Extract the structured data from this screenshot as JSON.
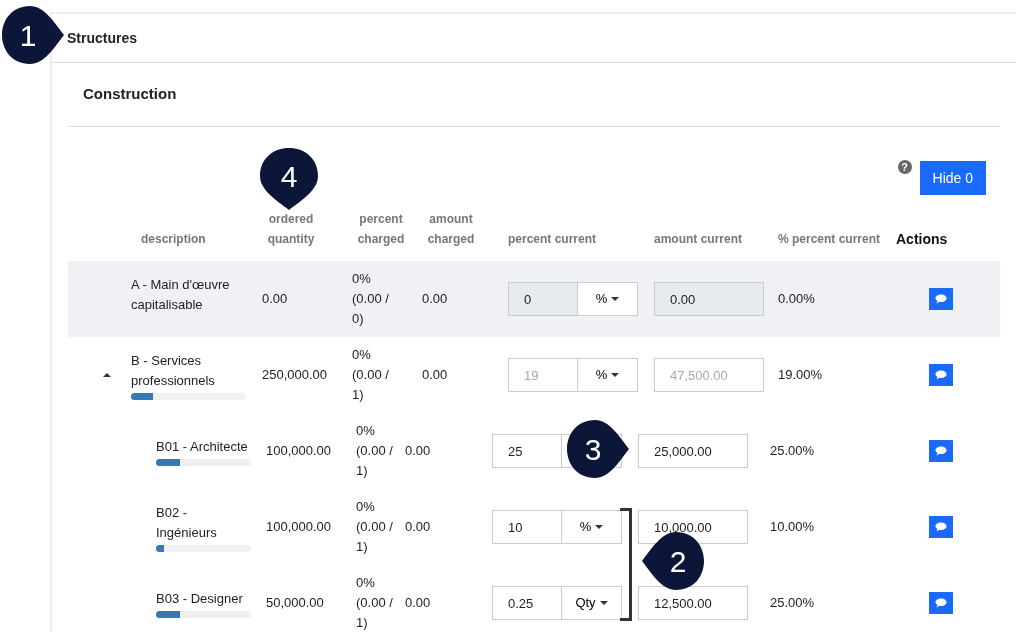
{
  "panel": {
    "title": "Structures"
  },
  "section": {
    "title": "Construction"
  },
  "toolbar": {
    "help": "?",
    "hide_button": "Hide 0"
  },
  "table": {
    "columns": [
      {
        "label": "description",
        "kind": "plain"
      },
      {
        "label": "ordered quantity",
        "kind": "plain"
      },
      {
        "label": "percent charged",
        "kind": "plain"
      },
      {
        "label": "amount charged",
        "kind": "plain"
      },
      {
        "label": "percent current",
        "kind": "plain"
      },
      {
        "label": "amount current",
        "kind": "plain"
      },
      {
        "label": "% percent current",
        "kind": "plain"
      },
      {
        "label": "Actions",
        "kind": "strong"
      }
    ],
    "rows": [
      {
        "description": "A - Main d'œuvre capitalisable",
        "level": 0,
        "ordered_quantity": "0.00",
        "percent_charged": "0% (0.00 / 0)",
        "amount_charged": "0.00",
        "percent_value": "0",
        "unit": "%",
        "amount_current": "0.00",
        "percent_current": "0.00%",
        "readonly": true,
        "disabled": false,
        "shaded": true
      },
      {
        "description": "B - Services professionnels",
        "level": 0.19,
        "expanded": true,
        "ordered_quantity": "250,000.00",
        "percent_charged": "0% (0.00 / 1)",
        "amount_charged": "0.00",
        "percent_value": "19",
        "unit": "%",
        "amount_current": "47,500.00",
        "percent_current": "19.00%",
        "readonly": false,
        "disabled": true,
        "shaded": false,
        "children": [
          {
            "description": "B01 - Architecte",
            "level": 0.25,
            "ordered_quantity": "100,000.00",
            "percent_charged": "0% (0.00 / 1)",
            "amount_charged": "0.00",
            "percent_value": "25",
            "amount_current": "25,000.00",
            "percent_current": "25.00%",
            "readonly": false,
            "disabled": false,
            "shaded": false
          },
          {
            "description": "B02 - Ingénieurs",
            "level": 0.08,
            "ordered_quantity": "100,000.00",
            "percent_charged": "0% (0.00 / 1)",
            "amount_charged": "0.00",
            "percent_value": "10",
            "unit": "%",
            "amount_current": "10,000.00",
            "percent_current": "10.00%",
            "readonly": false,
            "disabled": false,
            "shaded": false
          },
          {
            "description": "B03 - Designer",
            "level": 0.25,
            "ordered_quantity": "50,000.00",
            "percent_charged": "0% (0.00 / 1)",
            "amount_charged": "0.00",
            "percent_value": "0.25",
            "unit": "Qty",
            "amount_current": "12,500.00",
            "percent_current": "25.00%",
            "readonly": false,
            "disabled": false,
            "shaded": false
          }
        ]
      }
    ]
  },
  "annotations": [
    {
      "label": "1",
      "kind": "right"
    },
    {
      "label": "4",
      "kind": "down"
    },
    {
      "label": "3",
      "kind": "right"
    },
    {
      "label": "2",
      "kind": "left"
    }
  ]
}
